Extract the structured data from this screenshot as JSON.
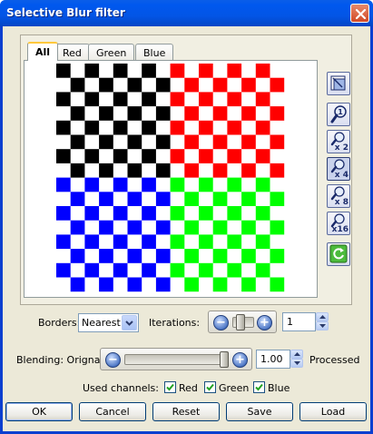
{
  "window": {
    "title": "Selective Blur filter"
  },
  "tabs": [
    {
      "label": "All",
      "active": true
    },
    {
      "label": "Red",
      "active": false
    },
    {
      "label": "Green",
      "active": false
    },
    {
      "label": "Blue",
      "active": false
    }
  ],
  "preview": {
    "quadrants": [
      "#000000",
      "#ff0000",
      "#0000ff",
      "#00ff00"
    ],
    "pattern": "checkerboard"
  },
  "tools": [
    {
      "name": "fit-to-view-icon",
      "zoom": ""
    },
    {
      "name": "zoom-1x-icon",
      "zoom": ""
    },
    {
      "name": "zoom-2x-icon",
      "zoom": "x 2"
    },
    {
      "name": "zoom-4x-icon",
      "zoom": "x 4",
      "pressed": true
    },
    {
      "name": "zoom-8x-icon",
      "zoom": "x 8"
    },
    {
      "name": "zoom-16x-icon",
      "zoom": "x16"
    },
    {
      "name": "refresh-icon",
      "zoom": ""
    }
  ],
  "borders": {
    "label": "Borders:",
    "value": "Nearest"
  },
  "iterations": {
    "label": "Iterations:",
    "value": "1",
    "minus": "−",
    "plus": "+"
  },
  "blending": {
    "label": "Blending: Orignal",
    "value": "1.00",
    "end_label": "Processed",
    "level": 1.0,
    "minus": "−",
    "plus": "+"
  },
  "channels": {
    "label": "Used channels:",
    "items": [
      {
        "label": "Red",
        "checked": true
      },
      {
        "label": "Green",
        "checked": true
      },
      {
        "label": "Blue",
        "checked": true
      }
    ]
  },
  "buttons": {
    "ok": "OK",
    "cancel": "Cancel",
    "reset": "Reset",
    "save": "Save",
    "load": "Load"
  },
  "colors": {
    "titlebar": "#0058ee",
    "dialog": "#ece9d8",
    "accent": "#ffc83c"
  }
}
